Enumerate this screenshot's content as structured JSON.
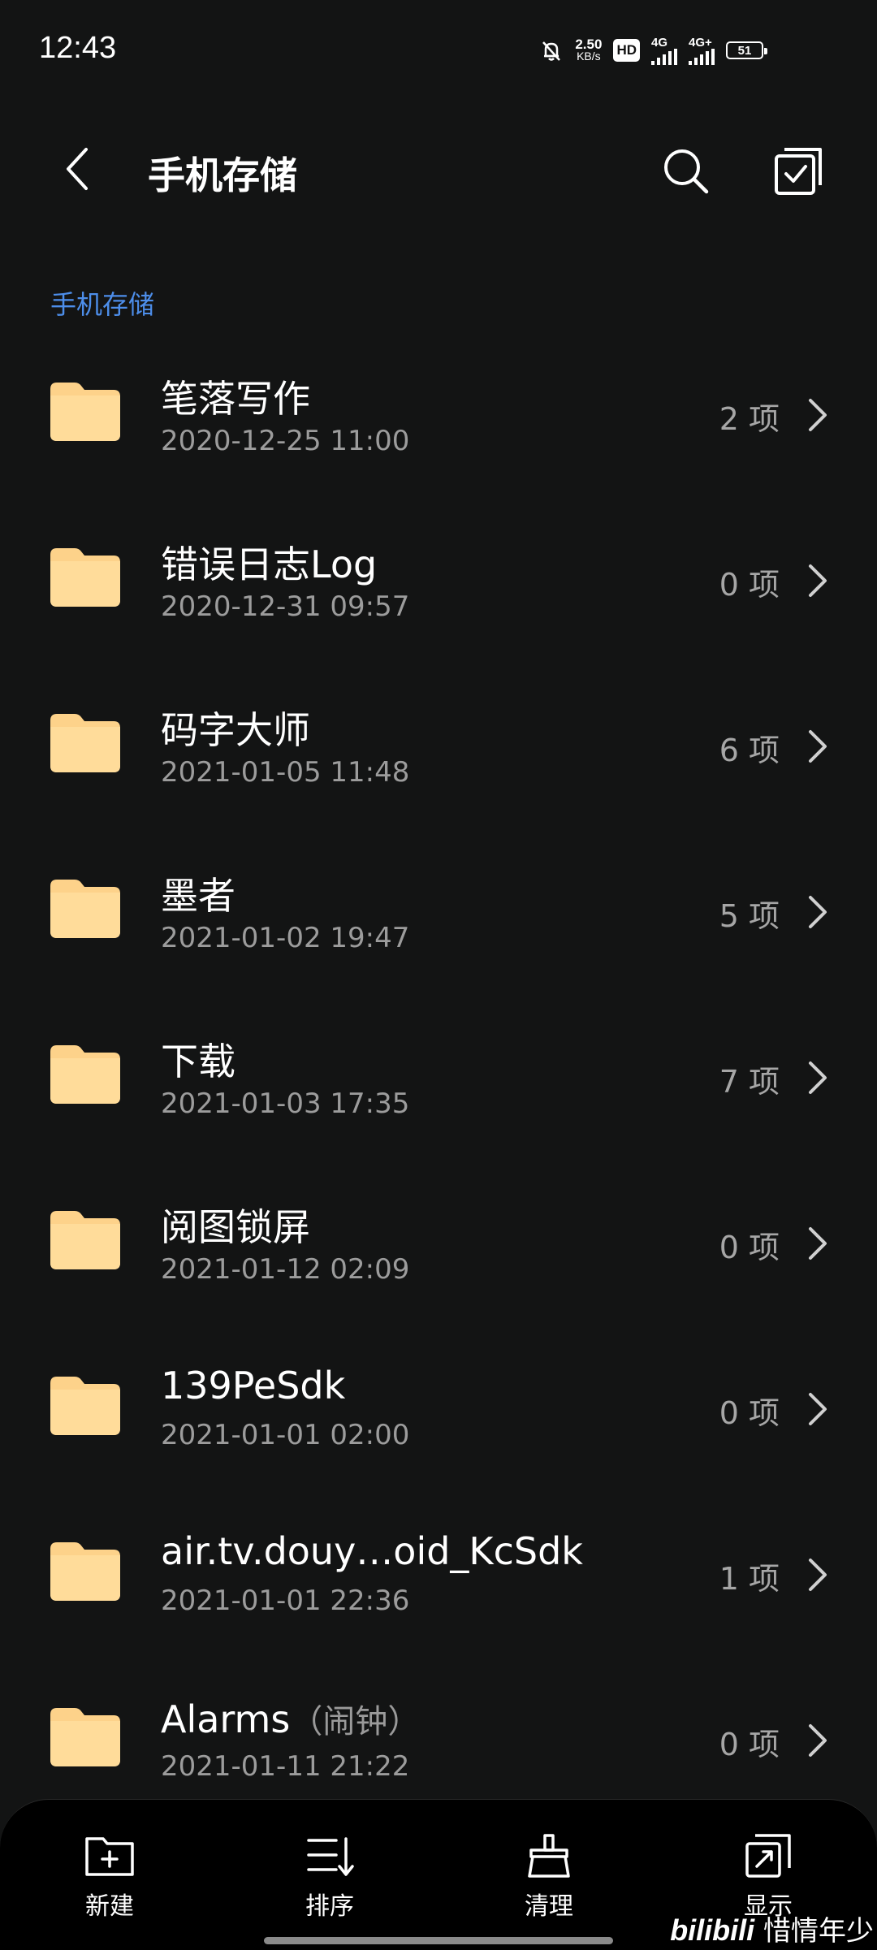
{
  "status_bar": {
    "time": "12:43",
    "speed_value": "2.50",
    "speed_unit": "KB/s",
    "hd_label": "HD",
    "sim1_network": "4G",
    "sim2_network": "4G+",
    "battery": "51"
  },
  "header": {
    "title": "手机存储"
  },
  "breadcrumb": "手机存储",
  "files": [
    {
      "name": "笔落写作",
      "name_sub": "",
      "date": "2020-12-25 11:00",
      "count": "2 项"
    },
    {
      "name": "错误日志Log",
      "name_sub": "",
      "date": "2020-12-31 09:57",
      "count": "0 项"
    },
    {
      "name": "码字大师",
      "name_sub": "",
      "date": "2021-01-05 11:48",
      "count": "6 项"
    },
    {
      "name": "墨者",
      "name_sub": "",
      "date": "2021-01-02 19:47",
      "count": "5 项"
    },
    {
      "name": "下载",
      "name_sub": "",
      "date": "2021-01-03 17:35",
      "count": "7 项"
    },
    {
      "name": "阅图锁屏",
      "name_sub": "",
      "date": "2021-01-12 02:09",
      "count": "0 项"
    },
    {
      "name": "139PeSdk",
      "name_sub": "",
      "date": "2021-01-01 02:00",
      "count": "0 项"
    },
    {
      "name": "air.tv.douy…oid_KcSdk",
      "name_sub": "",
      "date": "2021-01-01 22:36",
      "count": "1 项"
    },
    {
      "name": "Alarms",
      "name_sub": "（闹钟）",
      "date": "2021-01-11 21:22",
      "count": "0 项"
    }
  ],
  "bottom_nav": [
    {
      "label": "新建",
      "icon": "new-folder-icon"
    },
    {
      "label": "排序",
      "icon": "sort-icon"
    },
    {
      "label": "清理",
      "icon": "clean-brush-icon"
    },
    {
      "label": "显示",
      "icon": "display-icon"
    }
  ],
  "watermark": {
    "brand": "bilibili",
    "user": "惜情年少"
  },
  "colors": {
    "background": "#131414",
    "accent": "#4d8eea",
    "folder": "#fdd28a",
    "secondary_text": "#9c9c9c"
  }
}
